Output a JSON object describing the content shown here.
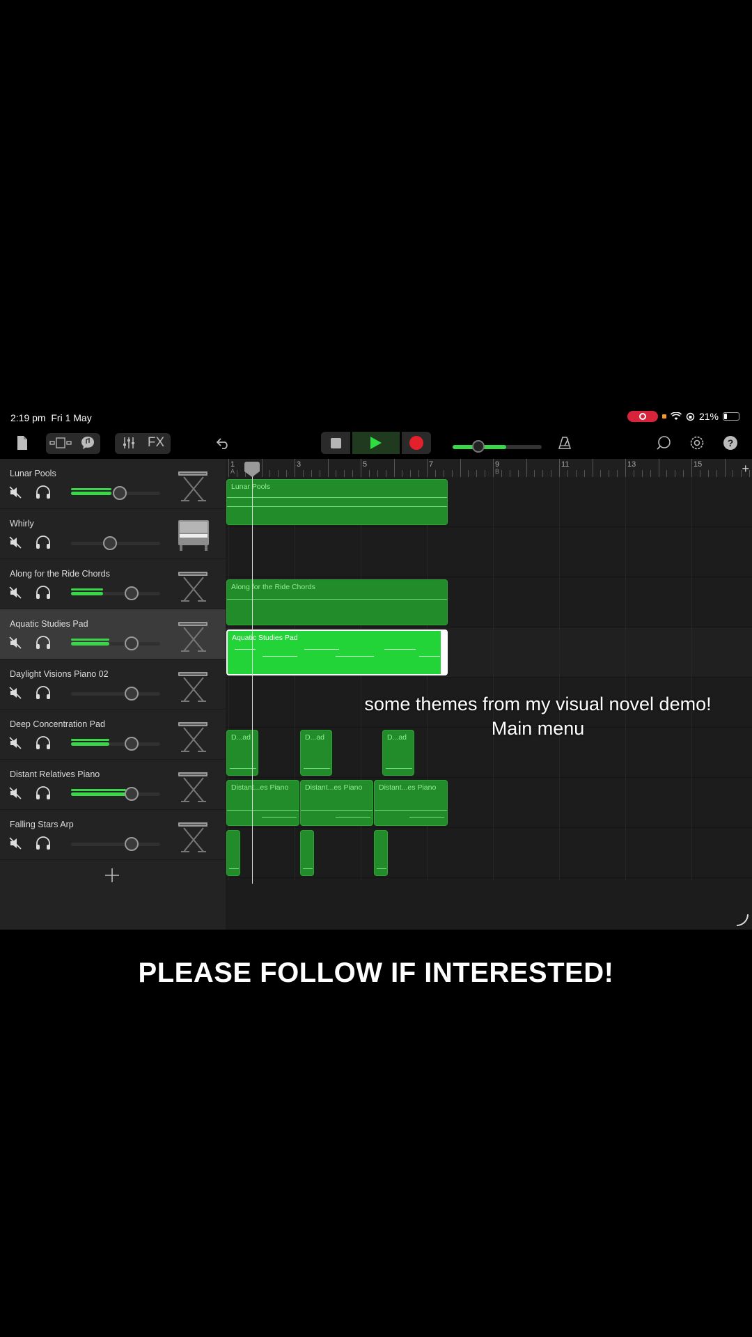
{
  "status": {
    "time": "2:19 pm",
    "date": "Fri 1 May",
    "battery": "21%"
  },
  "toolbar": {
    "fx_label": "FX"
  },
  "master_volume": 0.6,
  "tracks": [
    {
      "name": "Lunar Pools",
      "volume": 0.55,
      "level": 0.45,
      "instrument": "synth-stand"
    },
    {
      "name": "Whirly",
      "volume": 0.44,
      "level": 0.0,
      "instrument": "upright-piano"
    },
    {
      "name": "Along for the Ride Chords",
      "volume": 0.68,
      "level": 0.36,
      "instrument": "synth-stand"
    },
    {
      "name": "Aquatic Studies Pad",
      "volume": 0.68,
      "level": 0.43,
      "instrument": "synth-stand"
    },
    {
      "name": "Daylight Visions Piano 02",
      "volume": 0.68,
      "level": 0.0,
      "instrument": "synth-stand"
    },
    {
      "name": "Deep Concentration Pad",
      "volume": 0.68,
      "level": 0.43,
      "instrument": "synth-stand"
    },
    {
      "name": "Distant Relatives Piano",
      "volume": 0.68,
      "level": 0.62,
      "instrument": "synth-stand"
    },
    {
      "name": "Falling Stars Arp",
      "volume": 0.68,
      "level": 0.0,
      "instrument": "synth-stand"
    }
  ],
  "ruler": {
    "bars": [
      "1",
      "3",
      "5",
      "7",
      "9",
      "11",
      "13",
      "15"
    ],
    "markers": [
      "A",
      "B"
    ]
  },
  "regions": {
    "lunar_pools": "Lunar Pools",
    "along_for_the_ride": "Along for the Ride Chords",
    "aquatic_studies": "Aquatic Studies Pad",
    "deep_concentration": [
      "D...ad",
      "D...ad",
      "D...ad"
    ],
    "distant_relatives": [
      "Distant...es Piano",
      "Distant...es Piano",
      "Distant...es Piano"
    ]
  },
  "captions": {
    "line1": "some themes from my visual novel demo!",
    "line2": "Main menu",
    "follow": "PLEASE FOLLOW IF INTERESTED!"
  },
  "colors": {
    "region": "#238c2a",
    "region_selected": "#22d438",
    "record": "#e3202b",
    "play": "#2fdc3f"
  }
}
